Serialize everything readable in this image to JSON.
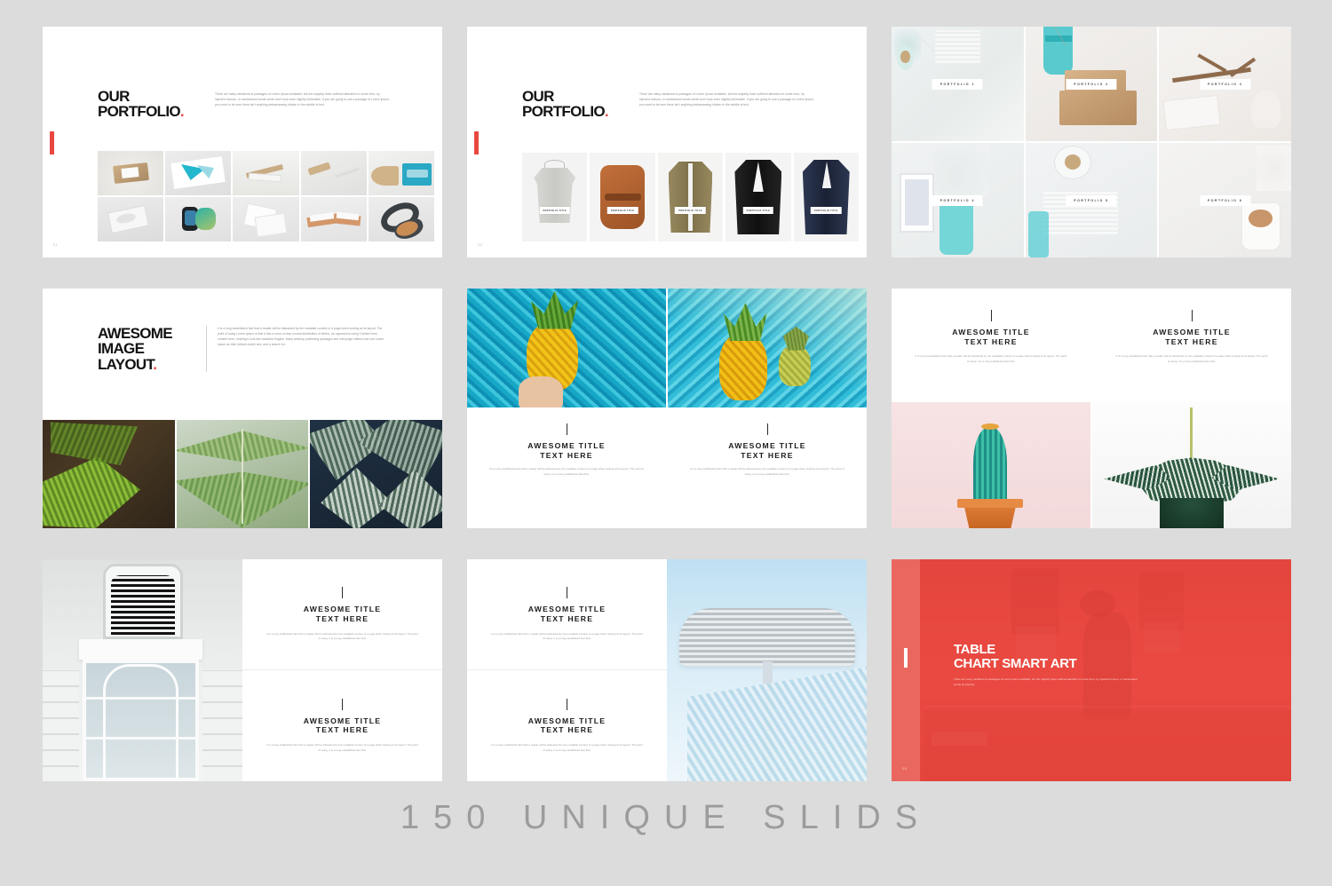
{
  "background_color": "#dcdcdc",
  "accent_color": "#e8483f",
  "caption": "150 UNIQUE SLIDS",
  "lorem": {
    "portfolio_intro": "There are many variations of passages of Lorem Ipsum available, but the majority have suffered alteration in some form, by injected humour, or randomised words which don't look even slightly believable. If you are going to use a passage of Lorem Ipsum, you need to be sure there isn't anything embarrassing hidden in the middle of text.",
    "image_layout_intro": "It is a long established fact that a reader will be distracted by the readable content of a page when looking at its layout. The point of using Lorem Ipsum is that it has a more-or-less normal distribution of letters, as opposed to using 'Content here, content here', making it look like readable English. Many desktop publishing packages and web page editors now use Lorem Ipsum as their default model text, and a search for.",
    "section_copy": "It is a long established fact that a reader will be distracted by the readable content of a page when looking at its layout. The point of using, it is a long established fact that.",
    "section_copy_wide": "It is a long established fact that a reader will be distracted by the readable content of a page when looking at its layout. The point of using, it is a long established fact that.",
    "table_intro": "There are many variations of passages of Lorem Ipsum available, but the majority have suffered alteration in some form, by injected humour, or randomised words by injected."
  },
  "slides": [
    {
      "id": "slide-portfolio-products",
      "page_number": "01",
      "title_line1": "OUR",
      "title_line2": "PORTFOLIO",
      "title_dot": ".",
      "items": [
        {
          "alt": "cardboard-box-mockup"
        },
        {
          "alt": "teal-folded-paper-mockup"
        },
        {
          "alt": "paper-stand-mockup"
        },
        {
          "alt": "wood-block-pens-mockup"
        },
        {
          "alt": "teal-mug-mockup"
        },
        {
          "alt": "business-card-mockup"
        },
        {
          "alt": "smartwatch-mockup"
        },
        {
          "alt": "a5-paper-mockup"
        },
        {
          "alt": "stacked-cards-mockup"
        },
        {
          "alt": "headphones-mockup"
        }
      ]
    },
    {
      "id": "slide-portfolio-apparel",
      "page_number": "02",
      "title_line1": "OUR",
      "title_line2": "PORTFOLIO",
      "title_dot": ".",
      "tag_label": "PORTFOLIO TITLE",
      "items": [
        {
          "alt": "grey-sweater"
        },
        {
          "alt": "brown-leather-backpack"
        },
        {
          "alt": "olive-blazer"
        },
        {
          "alt": "black-suit"
        },
        {
          "alt": "navy-double-breasted-suit"
        }
      ]
    },
    {
      "id": "slide-portfolio-grid",
      "labels": [
        "PORTFOLIO 1",
        "PORTFOLIO 2",
        "PORTFOLIO 3",
        "PORTFOLIO 4",
        "PORTFOLIO 5",
        "PORTFOLIO 6"
      ]
    },
    {
      "id": "slide-awesome-image-layout",
      "title_line1": "AWESOME",
      "title_line2": "IMAGE",
      "title_line3": "LAYOUT",
      "title_dot": ".",
      "images": [
        {
          "alt": "fern-dark-green"
        },
        {
          "alt": "fern-light-green"
        },
        {
          "alt": "fern-blue-green"
        }
      ]
    },
    {
      "id": "slide-pineapple-two-col",
      "columns": [
        {
          "title_line1": "AWESOME TITLE",
          "title_line2": "TEXT HERE",
          "image_alt": "hand-holding-pineapple-pool"
        },
        {
          "title_line1": "AWESOME TITLE",
          "title_line2": "TEXT HERE",
          "image_alt": "two-pineapples-pool"
        }
      ]
    },
    {
      "id": "slide-plants-two-col",
      "columns": [
        {
          "title_line1": "AWESOME TITLE",
          "title_line2": "TEXT HERE",
          "image_alt": "cactus-in-orange-pot"
        },
        {
          "title_line1": "AWESOME TITLE",
          "title_line2": "TEXT HERE",
          "image_alt": "aloe-succulent"
        }
      ]
    },
    {
      "id": "slide-window-left-image",
      "image_alt": "white-shutter-window-architecture",
      "cells": [
        {
          "title_line1": "AWESOME TITLE",
          "title_line2": "TEXT HERE"
        },
        {
          "title_line1": "AWESOME TITLE",
          "title_line2": "TEXT HERE"
        }
      ]
    },
    {
      "id": "slide-building-right-image",
      "image_alt": "modern-lattice-building",
      "cells": [
        {
          "title_line1": "AWESOME TITLE",
          "title_line2": "TEXT HERE"
        },
        {
          "title_line1": "AWESOME TITLE",
          "title_line2": "TEXT HERE"
        }
      ]
    },
    {
      "id": "slide-table-chart-smart-art",
      "page_number": "09",
      "title_line1": "TABLE",
      "title_line2": "CHART SMART ART",
      "image_alt": "man-walking-past-red-storefront"
    }
  ]
}
